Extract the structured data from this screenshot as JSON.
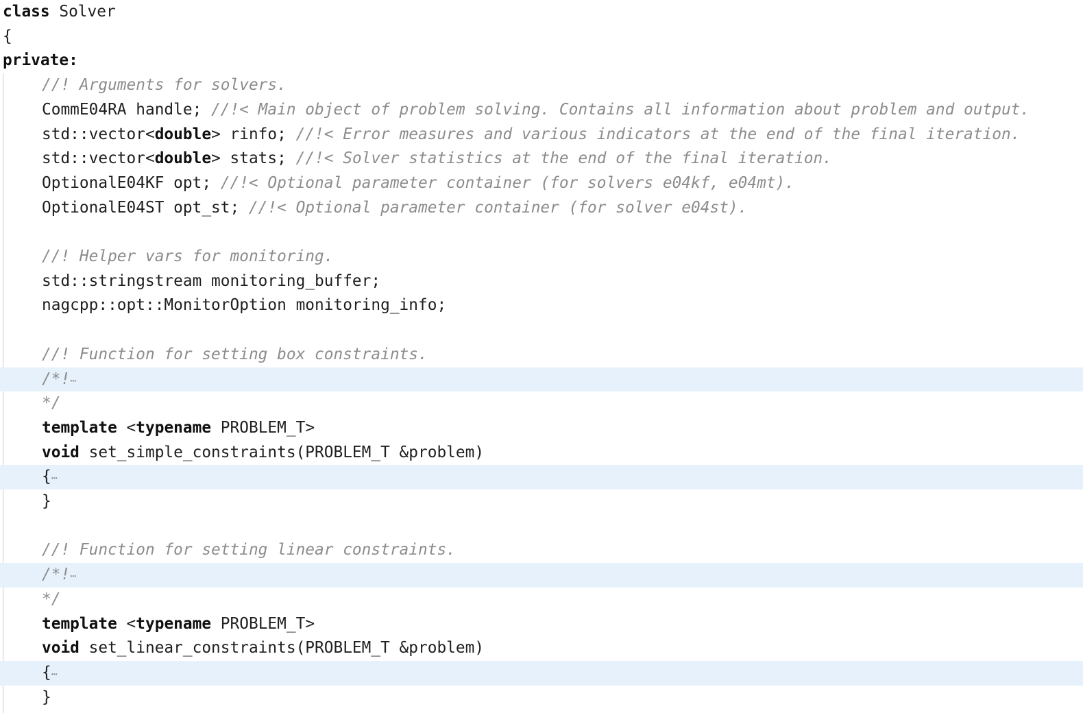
{
  "code": {
    "l1": {
      "kw": "class",
      "text": " Solver"
    },
    "l2": {
      "text": "{"
    },
    "l3": {
      "kw": "private:"
    },
    "l4": {
      "comment": "//! Arguments for solvers."
    },
    "l5": {
      "code": "CommE04RA handle; ",
      "comment": "//!< Main object of problem solving. Contains all information about problem and output."
    },
    "l6": {
      "pre": "std::vector<",
      "kw": "double",
      "post": "> rinfo; ",
      "comment": "//!< Error measures and various indicators at the end of the final iteration."
    },
    "l7": {
      "pre": "std::vector<",
      "kw": "double",
      "post": "> stats; ",
      "comment": "//!< Solver statistics at the end of the final iteration."
    },
    "l8": {
      "code": "OptionalE04KF opt; ",
      "comment": "//!< Optional parameter container (for solvers e04kf, e04mt)."
    },
    "l9": {
      "code": "OptionalE04ST opt_st; ",
      "comment": "//!< Optional parameter container (for solver e04st)."
    },
    "l11": {
      "comment": "//! Helper vars for monitoring."
    },
    "l12": {
      "code": "std::stringstream monitoring_buffer;"
    },
    "l13": {
      "code": "nagcpp::opt::MonitorOption monitoring_info;"
    },
    "l15": {
      "comment": "//! Function for setting box constraints."
    },
    "l16": {
      "comment": "/*!",
      "ellipsis": "⋯"
    },
    "l17": {
      "comment": "*/"
    },
    "l18": {
      "kw1": "template",
      "mid": " <",
      "kw2": "typename",
      "post": " PROBLEM_T>"
    },
    "l19": {
      "kw": "void",
      "text": " set_simple_constraints(PROBLEM_T &problem)"
    },
    "l20": {
      "text": "{",
      "ellipsis": "⋯"
    },
    "l21": {
      "text": "}"
    },
    "l23": {
      "comment": "//! Function for setting linear constraints."
    },
    "l24": {
      "comment": "/*!",
      "ellipsis": "⋯"
    },
    "l25": {
      "comment": "*/"
    },
    "l26": {
      "kw1": "template",
      "mid": " <",
      "kw2": "typename",
      "post": " PROBLEM_T>"
    },
    "l27": {
      "kw": "void",
      "text": " set_linear_constraints(PROBLEM_T &problem)"
    },
    "l28": {
      "text": "{",
      "ellipsis": "⋯"
    },
    "l29": {
      "text": "}"
    }
  },
  "colors": {
    "folded_background": "#e6f1fc",
    "comment": "#8c8c8c",
    "text": "#1f1f1f",
    "indent_guide": "#c9c9c9"
  }
}
